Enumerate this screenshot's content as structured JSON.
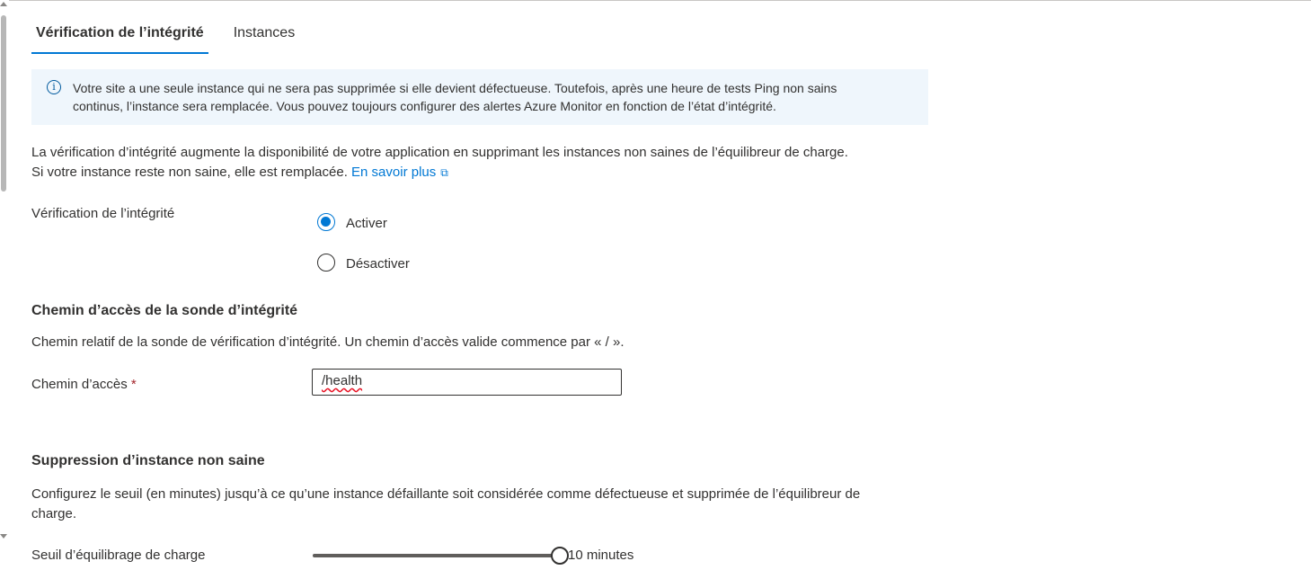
{
  "tabs": [
    {
      "label": "Vérification de l’intégrité",
      "active": true
    },
    {
      "label": "Instances",
      "active": false
    }
  ],
  "info": {
    "icon": "info-icon",
    "line1": "Votre site a une seule instance qui ne sera pas supprimée si elle devient défectueuse. Toutefois, après une heure de tests Ping non sains",
    "line2": "continus, l’instance sera remplacée. Vous pouvez toujours configurer des alertes Azure Monitor en fonction de l’état d’intégrité."
  },
  "description": {
    "line1": "La vérification d’intégrité augmente la disponibilité de votre application en supprimant les instances non saines de l’équilibreur de charge.",
    "line2": "Si votre instance reste non saine, elle est remplacée.",
    "link": "En savoir plus",
    "link_icon": "external-link-icon"
  },
  "health_check": {
    "label": "Vérification de l’intégrité",
    "options": [
      {
        "label": "Activer",
        "checked": true
      },
      {
        "label": "Désactiver",
        "checked": false
      }
    ]
  },
  "probe_path": {
    "title": "Chemin d’accès de la sonde d’intégrité",
    "description": "Chemin relatif de la sonde de vérification d’intégrité. Un chemin d’accès valide commence par « / ».",
    "field_label": "Chemin d’accès",
    "required_marker": "*",
    "value": "/health"
  },
  "unhealthy_removal": {
    "title": "Suppression d’instance non saine",
    "description_line1": "Configurez le seuil (en minutes) jusqu’à ce qu’une instance défaillante soit considérée comme défectueuse et supprimée de l’équilibreur de",
    "description_line2": "charge.",
    "slider_label": "Seuil d’équilibrage de charge",
    "slider_fraction": 1.0,
    "slider_value_text": "10 minutes"
  },
  "colors": {
    "accent": "#0078d4",
    "info_background": "#eff6fc",
    "required": "#a4262c"
  }
}
